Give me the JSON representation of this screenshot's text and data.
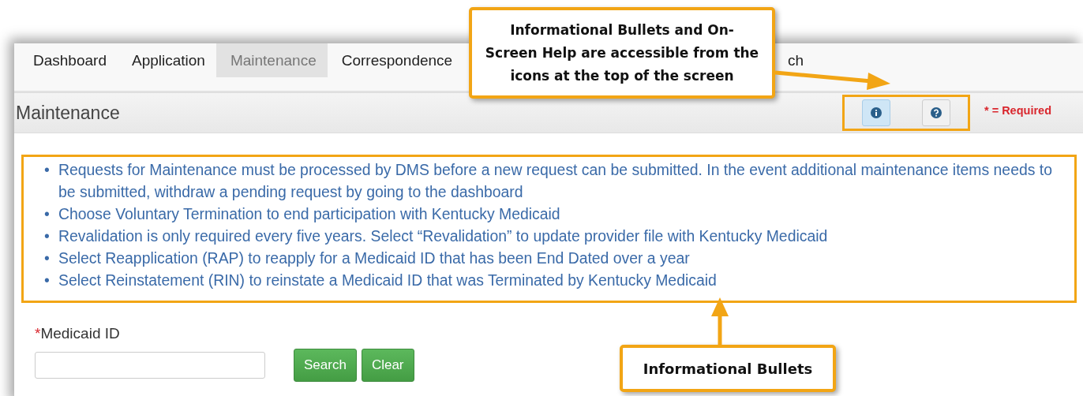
{
  "tabs": [
    {
      "label": "Dashboard",
      "selected": false
    },
    {
      "label": "Application",
      "selected": false
    },
    {
      "label": "Maintenance",
      "selected": true
    },
    {
      "label": "Correspondence",
      "selected": false
    },
    {
      "label": "ch",
      "selected": false
    }
  ],
  "header": {
    "title": "Maintenance",
    "required_mark": "* = Required"
  },
  "bullets": [
    {
      "marker": "•",
      "text": "Requests for Maintenance must be processed by DMS before a new request can be submitted. In the event additional maintenance items needs to be submitted, withdraw a pending request by going to the dashboard"
    },
    {
      "marker": "•",
      "text": "Choose Voluntary Termination to end participation with Kentucky Medicaid"
    },
    {
      "marker": "•",
      "text": "Revalidation is only required every five years. Select “Revalidation” to update provider file with Kentucky Medicaid"
    },
    {
      "marker": "•",
      "text": "Select Reapplication (RAP) to reapply for a Medicaid ID that has been End Dated over a year"
    },
    {
      "marker": "•",
      "text": "Select Reinstatement (RIN) to reinstate a Medicaid ID that was Terminated by Kentucky Medicaid"
    }
  ],
  "form": {
    "required_star": "*",
    "label": "Medicaid ID",
    "buttons": [
      "Search",
      "Clear"
    ]
  },
  "callouts": [
    "Informational Bullets and On-Screen Help are accessible from the icons at the top of the screen",
    "Informational Bullets"
  ]
}
